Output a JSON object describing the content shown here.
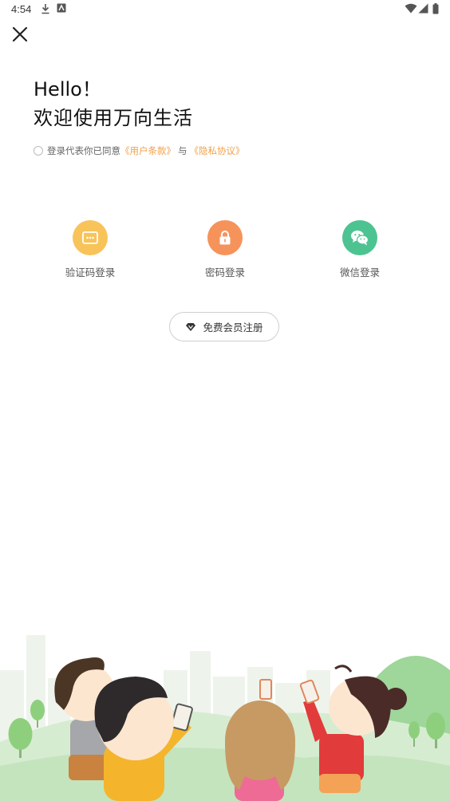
{
  "status_bar": {
    "time": "4:54"
  },
  "header": {
    "close_icon": "close-icon"
  },
  "greeting": {
    "hello": "Hello！",
    "welcome": "欢迎使用万向生活"
  },
  "agreement": {
    "prefix": "登录代表你已同意",
    "terms": "《用户条款》",
    "conjunction": "与",
    "privacy": "《隐私协议》"
  },
  "login_options": [
    {
      "label": "验证码登录",
      "icon": "message-icon",
      "color": "#f8c45a"
    },
    {
      "label": "密码登录",
      "icon": "lock-icon",
      "color": "#f6935b"
    },
    {
      "label": "微信登录",
      "icon": "wechat-icon",
      "color": "#4ec392"
    }
  ],
  "register": {
    "label": "免费会员注册",
    "icon": "diamond-icon"
  },
  "colors": {
    "link": "#f0a04a",
    "background": "#ffffff"
  }
}
